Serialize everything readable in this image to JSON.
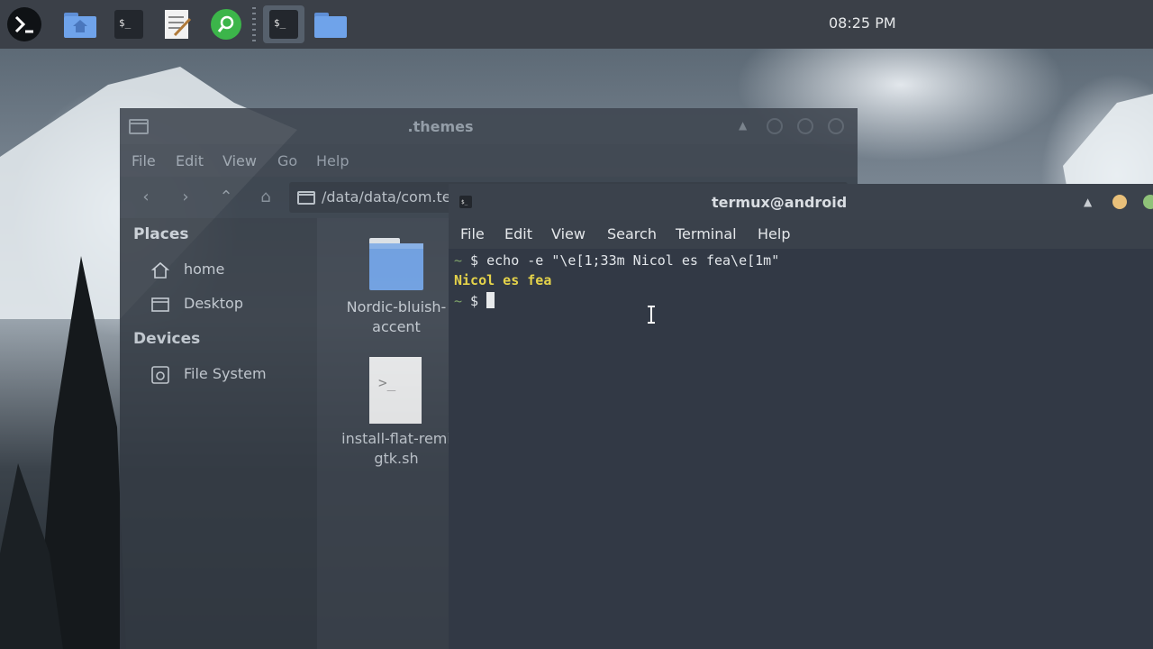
{
  "panel": {
    "launcher_icon": "terminal-prompt-icon",
    "apps": [
      {
        "name": "home-folder-icon"
      },
      {
        "name": "terminal-icon"
      },
      {
        "name": "text-editor-icon"
      },
      {
        "name": "search-app-icon"
      },
      {
        "name": "terminal-icon",
        "active": true
      },
      {
        "name": "folder-icon"
      }
    ],
    "clock": "08:25 PM"
  },
  "file_manager": {
    "title": ".themes",
    "menu": [
      "File",
      "Edit",
      "View",
      "Go",
      "Help"
    ],
    "location": "/data/data/com.termux/files/home/termux-desktop-",
    "sidebar": {
      "places_heading": "Places",
      "places": [
        "home",
        "Desktop"
      ],
      "devices_heading": "Devices",
      "devices": [
        "File System"
      ]
    },
    "files": [
      {
        "line1": "Nordic-bluish-",
        "line2": "accent",
        "icon": "folder-icon"
      },
      {
        "line1": "install-flat-remi",
        "line2": "gtk.sh",
        "icon": "script-file-icon"
      }
    ]
  },
  "terminal": {
    "title": "termux@android",
    "menu": [
      "File",
      "Edit",
      "View",
      "Search",
      "Terminal",
      "Help"
    ],
    "lines": [
      {
        "prefix": "~",
        "text": " $ echo -e \"\\e[1;33m Nicol es fea\\e[1m\""
      },
      {
        "output": "Nicol es fea"
      },
      {
        "prefix": "~",
        "text": " $ "
      }
    ]
  },
  "colors": {
    "accent_yellow": "#e5d34a",
    "prompt_tilde": "#7fa36a",
    "window_bg": "#353c47"
  }
}
